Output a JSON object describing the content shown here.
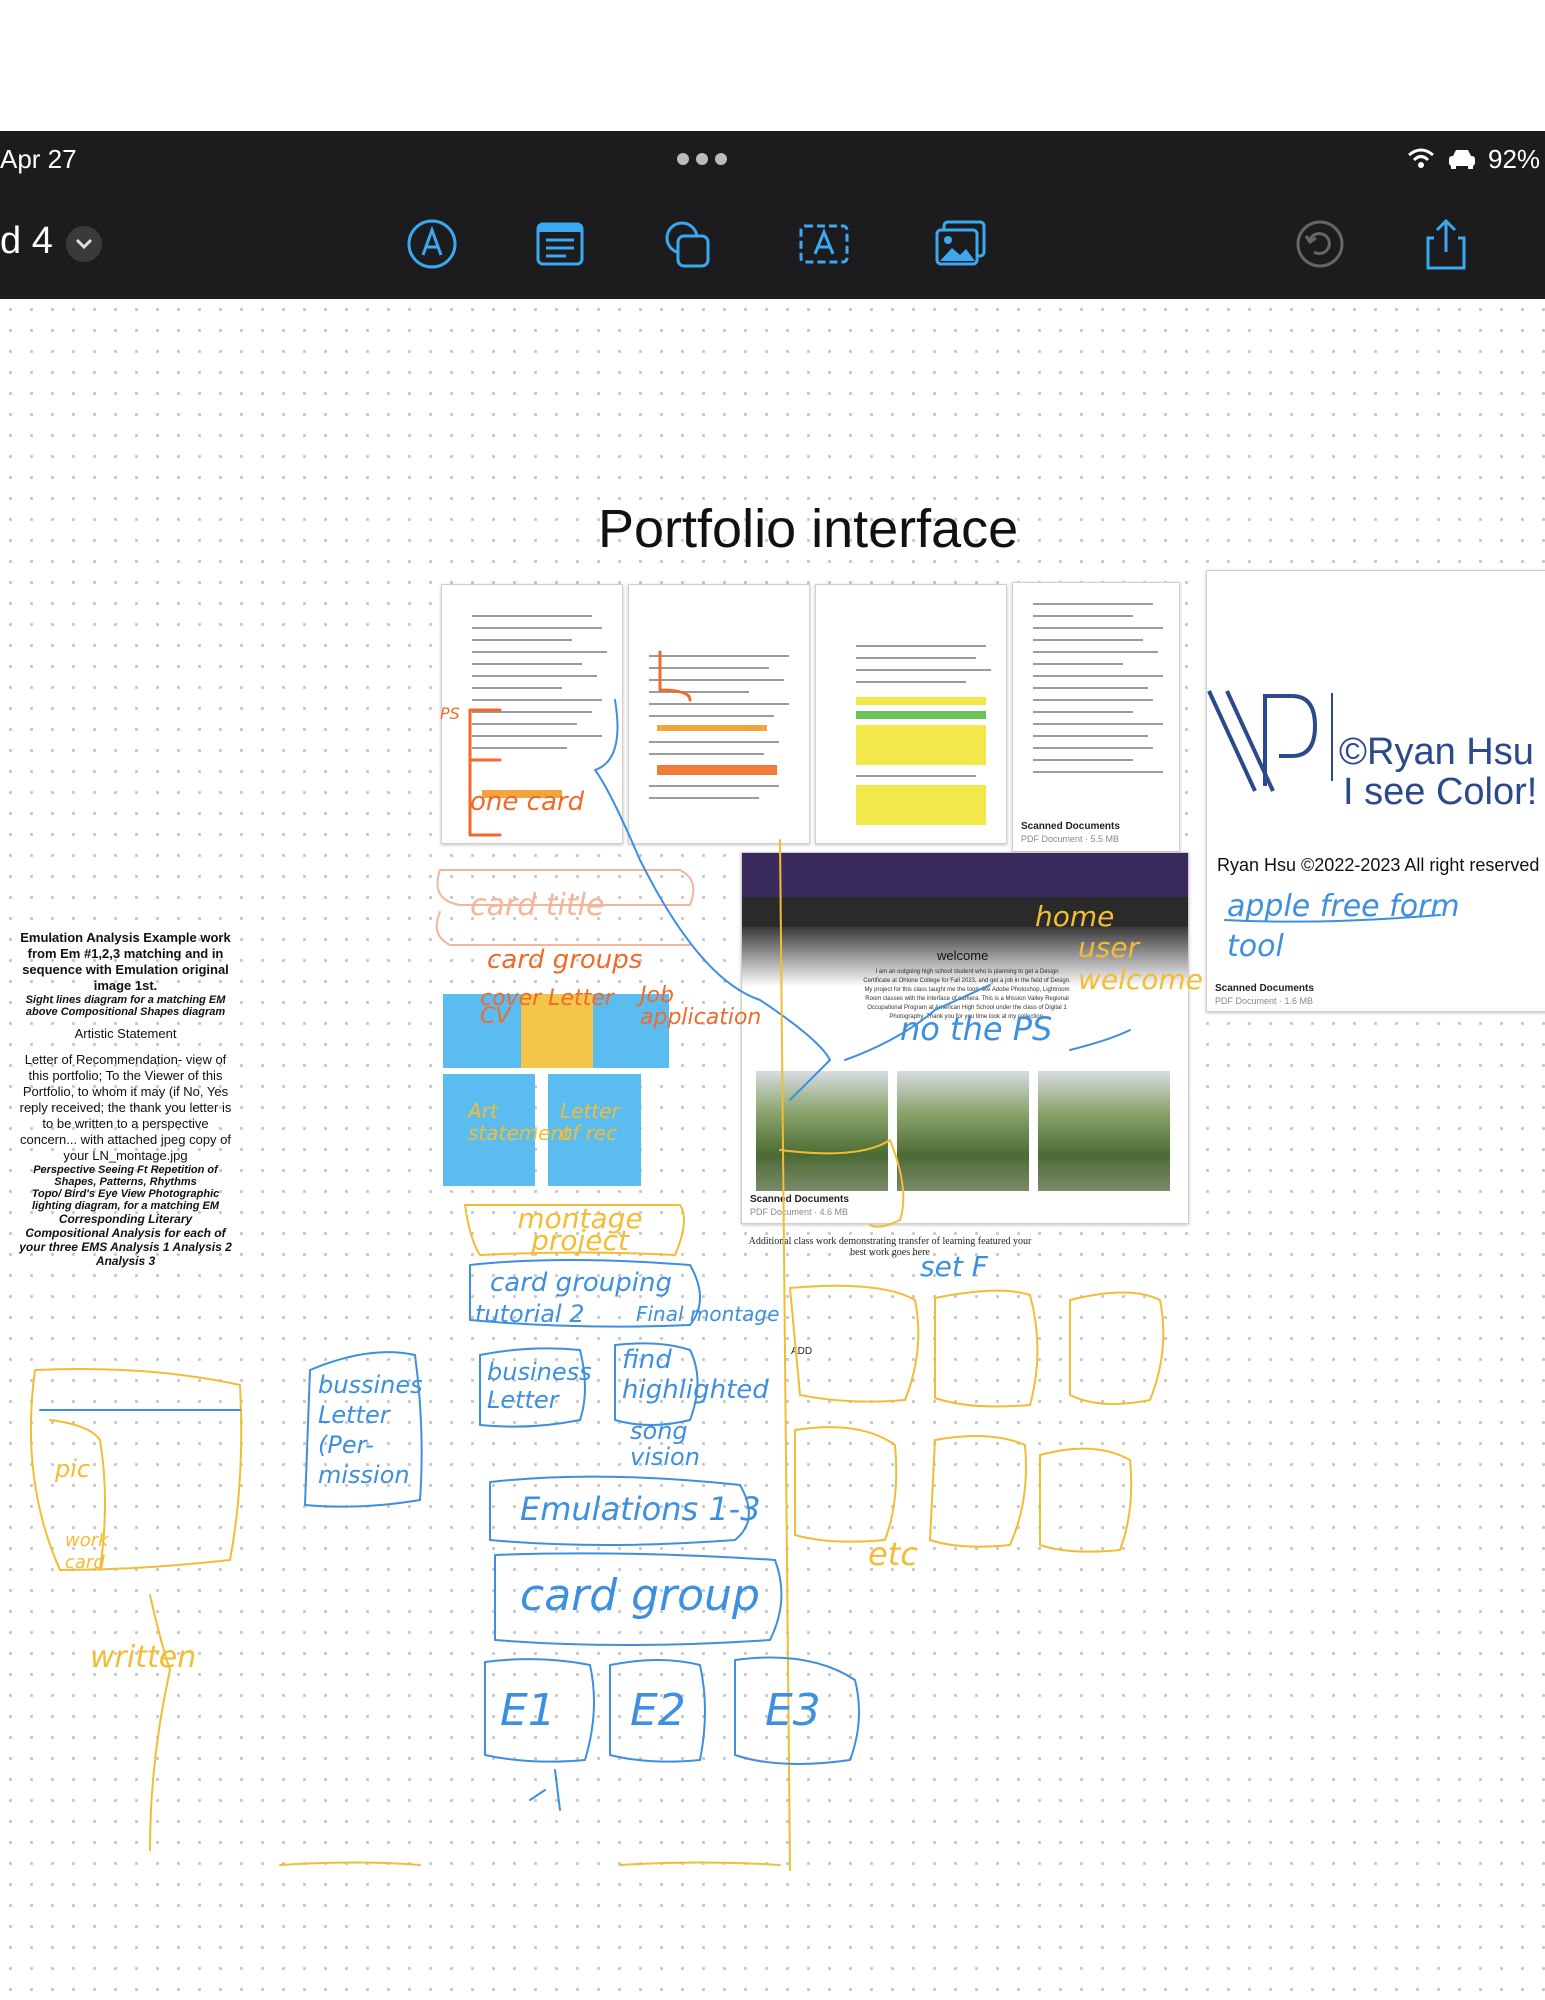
{
  "status_bar": {
    "date": "Apr 27",
    "battery": "92%"
  },
  "toolbar": {
    "doc_title": "d 4",
    "icons": [
      "pen-icon",
      "text-box-icon",
      "shapes-icon",
      "text-icon",
      "image-icon",
      "undo-icon",
      "share-icon"
    ]
  },
  "canvas": {
    "title": "Portfolio interface",
    "logo_card": {
      "name_line1": "©Ryan Hsu",
      "name_line2": "I see Color!",
      "copyright": "Ryan Hsu ©2022-2023 All right reserved",
      "handwriting": "apple free form tool",
      "caption_title": "Scanned Documents",
      "caption_sub": "PDF Document · 1.6 MB"
    },
    "thumb4_caption_title": "Scanned Documents",
    "thumb4_caption_sub": "PDF Document · 5.5 MB",
    "web_card": {
      "welcome": "welcome",
      "body": "I am an outgoing high school student who is planning to get a Design Certificate at Ohlone College for Fall 2023, and get a job in the field of Design. My project for this class taught me the tools like Adobe Photoshop, Lightroom Room classes with the interface of camera. This is a Mission Valley Regional Occupational Program at American High School under the class of Digital 1 Photography. Thank you for you time look at my collection.",
      "caption_title": "Scanned Documents",
      "caption_sub": "PDF Document · 4.6 MB"
    },
    "additional_text": "Additional class work demonstrating transfer of learning featured your best work goes here",
    "add_label": "ADD",
    "left_text": [
      {
        "text": "Emulation Analysis Example work from Em #1,2,3 matching and in sequence with Emulation original image 1st.",
        "style": "bold"
      },
      {
        "text": "Sight lines diagram for a matching EM above Compositional Shapes diagram",
        "style": "bolditalic"
      },
      {
        "text": "Artistic Statement",
        "style": "normal"
      },
      {
        "text": "Letter of Recommendation- view of this portfolio; To the Viewer of this Portfolio, to whom it may (if No, Yes reply received; the thank you letter is to be written to a perspective concern... with attached jpeg copy of your LN_montage.jpg",
        "style": "normal"
      },
      {
        "text": "Perspective Seeing Ft Repetition of Shapes, Patterns, Rhythms",
        "style": "bolditalic"
      },
      {
        "text": "Topo/ Bird's Eye View Photographic lighting diagram, for a matching EM",
        "style": "bolditalic"
      },
      {
        "text": "Corresponding Literary Compositional Analysis for each of your three EMS Analysis 1 Analysis 2 Analysis 3",
        "style": "bolditalic"
      }
    ],
    "handwriting": {
      "one_card": "one card",
      "card_title": "card title",
      "card_groups": "card groups",
      "cover_letter_cv": "cover Letter CV",
      "job_application": "Job application",
      "art_statement": "Art statement",
      "letter_of_rec": "Letter of rec",
      "home": "home",
      "user_welcome": "user welcome",
      "no_ps": "no the PS",
      "montage_project": "montage project",
      "card_grouping": "card grouping",
      "tutorial_2": "tutorial 2",
      "final_montage": "Final montage",
      "set_f": "set F",
      "business_letter_permission": "bussines Letter (Per-mission",
      "business_letter": "business Letter",
      "find_highlighted": "find highlighted",
      "song_vision": "song vision",
      "emulations": "Emulations 1-3",
      "card_group": "card group",
      "e1": "E1",
      "e2": "E2",
      "e3": "E3",
      "etc": "etc",
      "written": "written",
      "pic": "pic",
      "work_card": "work card",
      "ps": "PS"
    },
    "colors": {
      "toolbar": "#1c1c1e",
      "accent": "#3ba8f0",
      "sticky_blue": "#5bbcf0",
      "sticky_yellow": "#f3c64b",
      "ink_blue": "#3d8fe0",
      "ink_yellow": "#f2bd35",
      "ink_orange": "#ef6a2b"
    }
  }
}
